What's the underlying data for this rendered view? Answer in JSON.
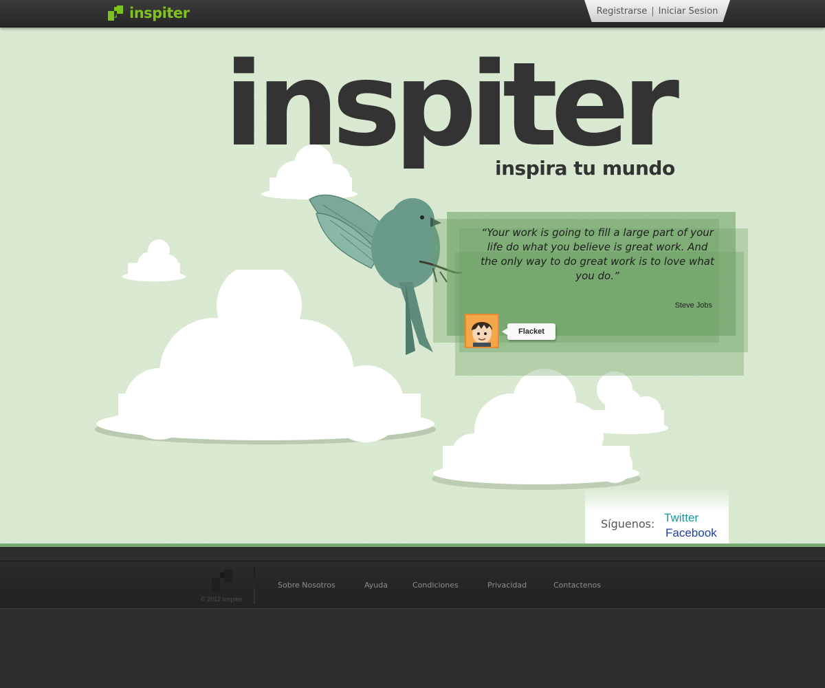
{
  "header": {
    "brand_name": "inspiter",
    "auth": {
      "register": "Registrarse",
      "separator": "|",
      "login": "Iniciar Sesion"
    }
  },
  "hero": {
    "logo_text": "inspiter",
    "tagline": "inspira tu mundo",
    "quote": {
      "text": "“Your work is going to fill a large part of your life do what you believe is great work. And the only way to do great work is to love what you do.”",
      "author": "Steve Jobs",
      "posted_by": "Flacket"
    }
  },
  "follow": {
    "label": "Síguenos:",
    "twitter": "Twitter",
    "facebook": "Facebook"
  },
  "footer": {
    "copyright": "© 2012 Inspiter",
    "links": [
      "Sobre Nosotros",
      "Ayuda",
      "Condiciones",
      "Privacidad",
      "Contactenos"
    ]
  },
  "colors": {
    "brand_green": "#7ec21f",
    "hero_bg": "#d7e8cf",
    "footer_bg": "#2c2c2c",
    "twitter": "#16979a",
    "facebook": "#1b3f9c"
  }
}
